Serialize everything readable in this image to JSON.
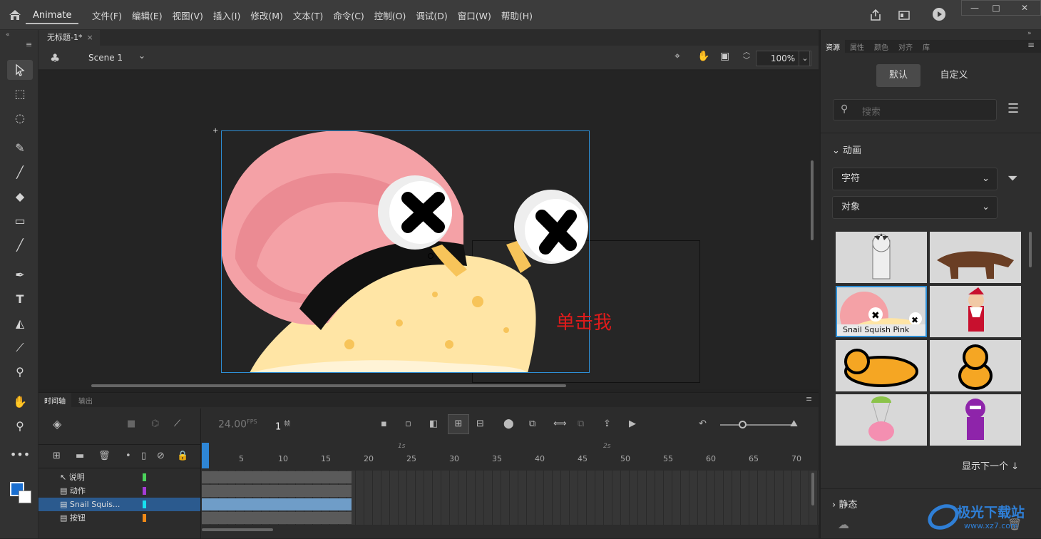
{
  "app": {
    "name": "Animate"
  },
  "menu": [
    "文件(F)",
    "编辑(E)",
    "视图(V)",
    "插入(I)",
    "修改(M)",
    "文本(T)",
    "命令(C)",
    "控制(O)",
    "调试(D)",
    "窗口(W)",
    "帮助(H)"
  ],
  "doc": {
    "tab": "无标题-1*",
    "scene": "Scene 1",
    "zoom": "100%"
  },
  "stage": {
    "button_text": "单击我"
  },
  "panel": {
    "tabs": [
      "资源",
      "属性",
      "颜色",
      "对齐",
      "库"
    ],
    "seg": [
      "默认",
      "自定义"
    ],
    "search_placeholder": "搜索",
    "section_anim": "动画",
    "filter1": "字符",
    "filter2": "对象",
    "thumb_label": "Snail Squish Pink",
    "show_next": "显示下一个 ↓",
    "section_static": "静态"
  },
  "timeline": {
    "tabs": [
      "时间轴",
      "输出"
    ],
    "fps": "24.00",
    "fps_unit": "FPS",
    "frame": "1",
    "frame_unit": "帧",
    "layers": [
      "说明",
      "动作",
      "Snail Squis...",
      "按钮"
    ],
    "ruler": [
      "5",
      "10",
      "15",
      "20",
      "25",
      "30",
      "35",
      "40",
      "45",
      "50",
      "55",
      "60",
      "65",
      "70"
    ],
    "sec": [
      "1s",
      "2s"
    ]
  },
  "watermark": {
    "cn": "极光下载站",
    "url": "www.xz7.com"
  }
}
